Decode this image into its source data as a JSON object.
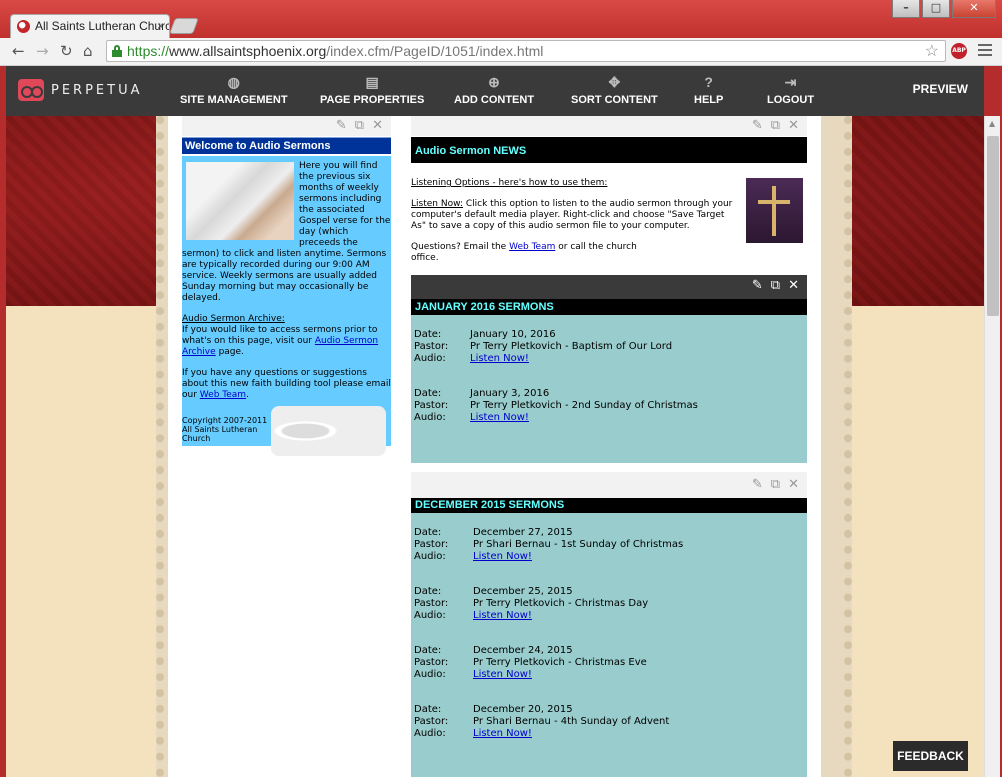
{
  "browser": {
    "tab_title": "All Saints Lutheran Church",
    "url_https": "https://",
    "url_domain": "www.allsaintsphoenix.org",
    "url_path": "/index.cfm/PageID/1051/index.html"
  },
  "cms": {
    "brand": "PERPETUA",
    "menu": [
      {
        "label": "SITE MANAGEMENT",
        "icon": "globe-icon"
      },
      {
        "label": "PAGE PROPERTIES",
        "icon": "page-icon"
      },
      {
        "label": "ADD CONTENT",
        "icon": "plus-circle-icon"
      },
      {
        "label": "SORT CONTENT",
        "icon": "move-icon"
      },
      {
        "label": "HELP",
        "icon": "help-icon"
      },
      {
        "label": "LOGOUT",
        "icon": "logout-icon"
      }
    ],
    "preview": "PREVIEW"
  },
  "welcome": {
    "title": "Welcome to Audio Sermons",
    "intro": "Here you will find the previous six months of weekly sermons including the associated Gospel verse for the day (which preceeds the sermon) to click and listen anytime. Sermons are typically recorded during our 9:00 AM service.  Weekly sermons are usually added Sunday morning but may occasionally be delayed.",
    "archive_heading": "Audio Sermon Archive:",
    "archive_text": "If you would like to access sermons prior to what's on this page, visit our",
    "archive_link": "Audio Sermon Archive",
    "archive_end": "page.",
    "questions_text": "If you have any questions or suggestions about this new faith building tool please email our",
    "web_team": "Web Team",
    "copyright": "Copyright 2007-2011 All Saints Lutheran Church"
  },
  "news": {
    "title": "Audio Sermon NEWS",
    "options_heading": "Listening Options - here's how to use them:",
    "listen_now_label": "Listen Now:",
    "listen_now_text": "Click this option to listen to the audio sermon through your computer's default media player. Right-click and choose \"Save Target As\" to save a copy of this audio sermon file to your computer.",
    "questions_label": "Questions?",
    "questions_text": "Email the",
    "web_team": "Web Team",
    "questions_end": "or call the church office."
  },
  "labels": {
    "date": "Date:",
    "pastor": "Pastor:",
    "audio": "Audio:",
    "listen": "Listen Now!"
  },
  "sections": [
    {
      "title": "JANUARY 2016 SERMONS",
      "sermons": [
        {
          "date": "January 10, 2016",
          "pastor": "Pr Terry Pletkovich - Baptism of Our Lord"
        },
        {
          "date": "January 3, 2016",
          "pastor": "Pr Terry Pletkovich - 2nd Sunday of Christmas"
        }
      ]
    },
    {
      "title": "DECEMBER 2015 SERMONS",
      "sermons": [
        {
          "date": "December 27, 2015",
          "pastor": "Pr Shari Bernau - 1st Sunday of Christmas"
        },
        {
          "date": "December 25, 2015",
          "pastor": "Pr Terry Pletkovich - Christmas Day"
        },
        {
          "date": "December 24, 2015",
          "pastor": "Pr Terry Pletkovich - Christmas Eve"
        },
        {
          "date": "December 20, 2015",
          "pastor": "Pr Shari Bernau - 4th Sunday of Advent"
        }
      ]
    }
  ],
  "feedback": "FEEDBACK"
}
